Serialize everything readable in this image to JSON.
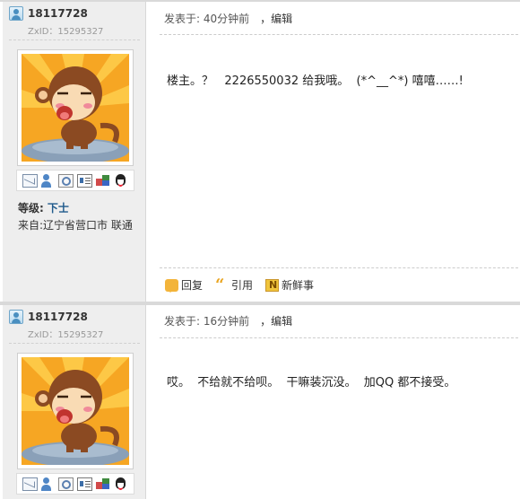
{
  "posts": [
    {
      "author": {
        "username": "18117728",
        "zxid": "ZxID：15295327",
        "rank_label": "等级:",
        "rank_value": "下士",
        "origin": "来自:辽宁省营口市 联通"
      },
      "meta": {
        "posted": "发表于: 40分钟前",
        "edit_label": "，编辑"
      },
      "content": "楼主。？   2226550032 给我哦。  (*^__^*) 嘻嘻……!",
      "actions": [
        {
          "label": "回复",
          "icon": "reply-icon"
        },
        {
          "label": "引用",
          "icon": "quote-icon"
        },
        {
          "label": "新鲜事",
          "icon": "news-icon"
        }
      ]
    },
    {
      "author": {
        "username": "18117728",
        "zxid": "ZxID：15295327"
      },
      "meta": {
        "posted": "发表于: 16分钟前",
        "edit_label": "，编辑"
      },
      "content": "哎。  不给就不给呗。  干嘛装沉没。  加QQ 都不接受。"
    }
  ],
  "colors": {
    "sidebar_bg": "#eeeeee",
    "rank_value": "#1f5a8c",
    "action_icon": "#f3b43a"
  }
}
